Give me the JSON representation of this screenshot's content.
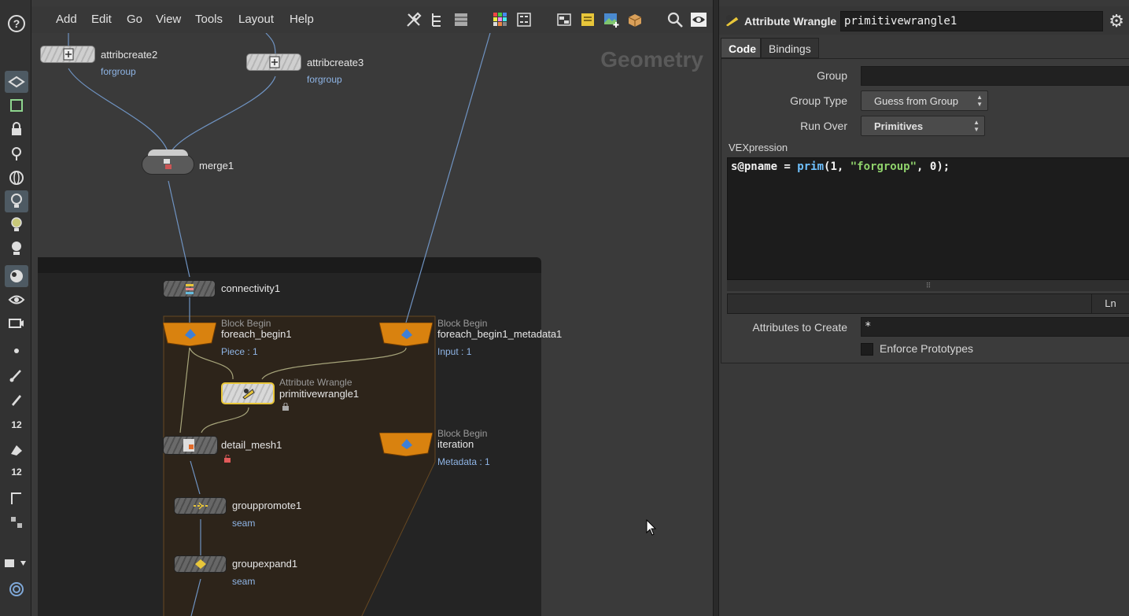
{
  "menubar": {
    "items": [
      "Add",
      "Edit",
      "Go",
      "View",
      "Tools",
      "Layout",
      "Help"
    ]
  },
  "network": {
    "context_label": "Geometry",
    "nodes": {
      "attribcreate2": {
        "name": "attribcreate2",
        "sub": "forgroup"
      },
      "attribcreate3": {
        "name": "attribcreate3",
        "sub": "forgroup"
      },
      "merge1": {
        "name": "merge1"
      },
      "connectivity1": {
        "name": "connectivity1"
      },
      "foreach_begin1": {
        "type": "Block Begin",
        "name": "foreach_begin1",
        "sub": "Piece : 1"
      },
      "foreach_begin1_metadata1": {
        "type": "Block Begin",
        "name": "foreach_begin1_metadata1",
        "sub": "Input : 1"
      },
      "primitivewrangle1": {
        "type": "Attribute Wrangle",
        "name": "primitivewrangle1"
      },
      "detail_mesh1": {
        "name": "detail_mesh1"
      },
      "iteration": {
        "type": "Block Begin",
        "name": "iteration",
        "sub": "Metadata : 1"
      },
      "grouppromote1": {
        "name": "grouppromote1",
        "sub": "seam"
      },
      "groupexpand1": {
        "name": "groupexpand1",
        "sub": "seam"
      }
    }
  },
  "shelf": {
    "help": "?",
    "num1": "12",
    "num2": "12"
  },
  "params": {
    "node_type": "Attribute Wrangle",
    "node_name": "primitivewrangle1",
    "tabs": [
      "Code",
      "Bindings"
    ],
    "group_label": "Group",
    "group_value": "",
    "group_type_label": "Group Type",
    "group_type_value": "Guess from Group",
    "run_over_label": "Run Over",
    "run_over_value": "Primitives",
    "vex_label": "VEXpression",
    "vex_code": {
      "p1": "s@pname = ",
      "func": "prim",
      "p2": "(1, ",
      "str": "\"forgroup\"",
      "p3": ", 0);"
    },
    "ln_label": "Ln",
    "attrs_label": "Attributes to Create",
    "attrs_value": "*",
    "enforce_label": "Enforce Prototypes"
  },
  "colors": {
    "accent_orange": "#d9820f",
    "wire": "#6f93c2",
    "wire_loop": "#a6a47a",
    "highlight_yellow": "#e8c63a"
  }
}
